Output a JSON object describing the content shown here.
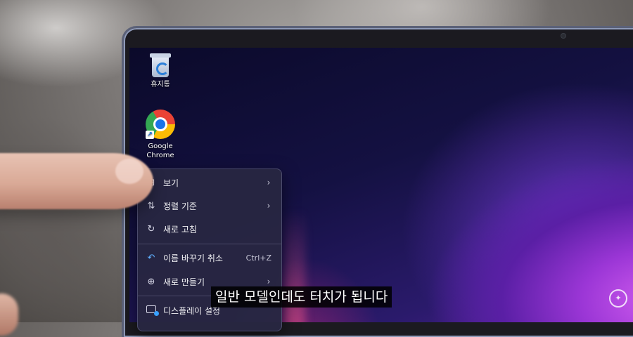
{
  "desktop": {
    "icons": [
      {
        "label": "휴지통",
        "icon": "recycle-bin-icon"
      },
      {
        "label_line1": "Google",
        "label_line2": "Chrome",
        "icon": "chrome-icon"
      }
    ]
  },
  "context_menu": {
    "items": [
      {
        "label": "보기",
        "icon": "view-grid-icon",
        "submenu": true
      },
      {
        "label": "정렬 기준",
        "icon": "sort-arrows-icon",
        "submenu": true
      },
      {
        "label": "새로 고침",
        "icon": "refresh-icon",
        "submenu": false
      },
      {
        "label": "이름 바꾸기 취소",
        "icon": "undo-icon",
        "shortcut": "Ctrl+Z"
      },
      {
        "label": "새로 만들기",
        "icon": "add-circle-icon",
        "submenu": true
      },
      {
        "label": "디스플레이 설정",
        "icon": "display-settings-icon",
        "submenu": false
      }
    ]
  },
  "caption": {
    "text": "일반 모델인데도 터치가 됩니다"
  }
}
